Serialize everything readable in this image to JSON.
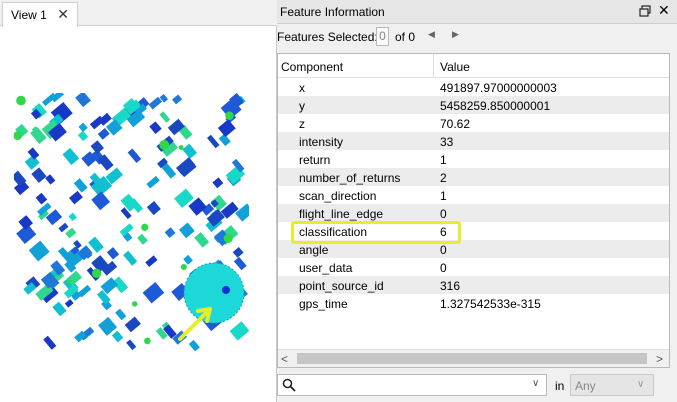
{
  "view": {
    "tab_label": "View 1",
    "close_glyph": "✕"
  },
  "info": {
    "title": "Feature Information",
    "float_icon": "float-icon",
    "close_glyph": "✕",
    "features_selected_label": "Features Selected:",
    "selected_value": "0",
    "of_label": "of 0",
    "prev_glyph": "◀",
    "next_glyph": "▶"
  },
  "table": {
    "col_component": "Component",
    "col_value": "Value",
    "rows": [
      {
        "key": "x",
        "value": "491897.97000000003"
      },
      {
        "key": "y",
        "value": "5458259.850000001"
      },
      {
        "key": "z",
        "value": "70.62"
      },
      {
        "key": "intensity",
        "value": "33"
      },
      {
        "key": "return",
        "value": "1"
      },
      {
        "key": "number_of_returns",
        "value": "2"
      },
      {
        "key": "scan_direction",
        "value": "1"
      },
      {
        "key": "flight_line_edge",
        "value": "0"
      },
      {
        "key": "classification",
        "value": "6"
      },
      {
        "key": "angle",
        "value": "0"
      },
      {
        "key": "user_data",
        "value": "0"
      },
      {
        "key": "point_source_id",
        "value": "316"
      },
      {
        "key": "gps_time",
        "value": "1.327542533e-315"
      }
    ],
    "scroll_left_glyph": "<",
    "scroll_right_glyph": ">"
  },
  "search": {
    "placeholder": "",
    "dropdown_glyph": "∨",
    "in_label": "in",
    "scope_value": "Any",
    "scope_glyph": "∨"
  },
  "colors": {
    "highlight": "#e6ee2a",
    "point_high": "#00e0e0",
    "point_low": "#1030c0"
  }
}
